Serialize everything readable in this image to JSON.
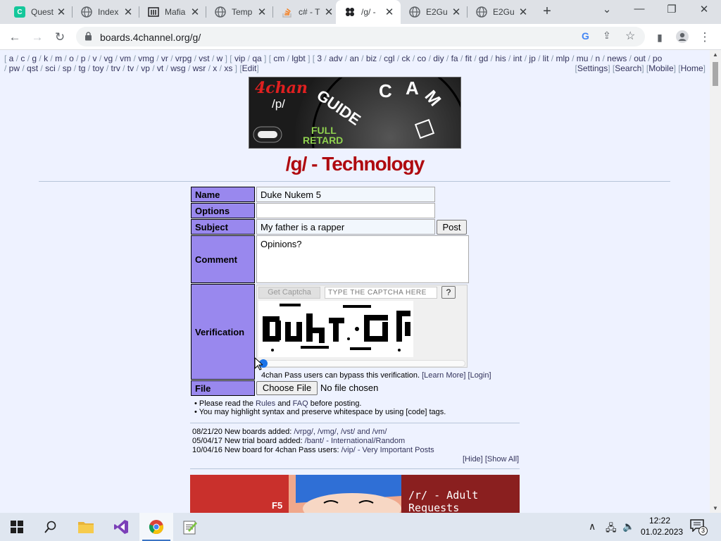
{
  "browser": {
    "tabs": [
      {
        "title": "Quest",
        "icon": "app-green-icon",
        "color": "#14c79b"
      },
      {
        "title": "Index",
        "icon": "globe-icon"
      },
      {
        "title": "Mafia",
        "icon": "building-icon"
      },
      {
        "title": "Temp",
        "icon": "globe-icon"
      },
      {
        "title": "c# - T",
        "icon": "stackoverflow-icon"
      },
      {
        "title": "/g/ -",
        "icon": "clover-icon"
      },
      {
        "title": "E2Gu",
        "icon": "globe-icon"
      },
      {
        "title": "E2Gu",
        "icon": "globe-icon"
      }
    ],
    "url": "boards.4channel.org/g/"
  },
  "nav": {
    "line1": [
      "a",
      "c",
      "g",
      "k",
      "m",
      "o",
      "p",
      "v",
      "vg",
      "vm",
      "vmg",
      "vr",
      "vrpg",
      "vst",
      "w"
    ],
    "line1b": [
      "vip",
      "qa"
    ],
    "line1c": [
      "cm",
      "lgbt"
    ],
    "line1d": [
      "3",
      "adv",
      "an",
      "biz",
      "cgl",
      "ck",
      "co",
      "diy",
      "fa",
      "fit",
      "gd",
      "his",
      "int",
      "jp",
      "lit",
      "mlp",
      "mu",
      "n",
      "news",
      "out",
      "po"
    ],
    "line2": [
      "pw",
      "qst",
      "sci",
      "sp",
      "tg",
      "toy",
      "trv",
      "tv",
      "vp",
      "vt",
      "wsg",
      "wsr",
      "x",
      "xs"
    ],
    "edit": "Edit",
    "right": [
      "Settings",
      "Search",
      "Mobile",
      "Home"
    ]
  },
  "banner": {
    "brand": "4chan",
    "board": "/p/",
    "guide": "GUIDE",
    "full": "FULL",
    "retard": "RETARD"
  },
  "board_title": "/g/ - Technology",
  "form": {
    "name_label": "Name",
    "name_value": "Duke Nukem 5",
    "options_label": "Options",
    "options_value": "",
    "subject_label": "Subject",
    "subject_value": "My father is a rapper",
    "post_button": "Post",
    "comment_label": "Comment",
    "comment_value": "Opinions?",
    "verification_label": "Verification",
    "get_captcha": "Get Captcha",
    "captcha_placeholder": "TYPE THE CAPTCHA HERE",
    "captcha_help": "?",
    "pass_note": "4chan Pass users can bypass this verification.",
    "learn_more": "[Learn More]",
    "login": "[Login]",
    "file_label": "File",
    "choose_file": "Choose File",
    "no_file": "No file chosen"
  },
  "notes": {
    "line1_pre": "• Please read the",
    "rules": "Rules",
    "and": "and",
    "faq": "FAQ",
    "line1_post": "before posting.",
    "line2": "• You may highlight syntax and preserve whitespace by using [code] tags."
  },
  "news": [
    {
      "date": "08/21/20",
      "pre": "New boards added:",
      "links": "/vrpg/, /vmg/, /vst/ and /vm/",
      "post": ""
    },
    {
      "date": "05/04/17",
      "pre": "New trial board added:",
      "links": "/bant/ - International/Random",
      "post": ""
    },
    {
      "date": "10/04/16",
      "pre": "New board for 4chan Pass users:",
      "links": "/vip/ - Very Important Posts",
      "post": ""
    }
  ],
  "hide": "[Hide]",
  "show_all": "[Show All]",
  "bottom_banner": {
    "text": "/r/ - Adult Requests",
    "tag": "F5"
  },
  "taskbar": {
    "time": "12:22",
    "date": "01.02.2023",
    "notifications": "3"
  }
}
